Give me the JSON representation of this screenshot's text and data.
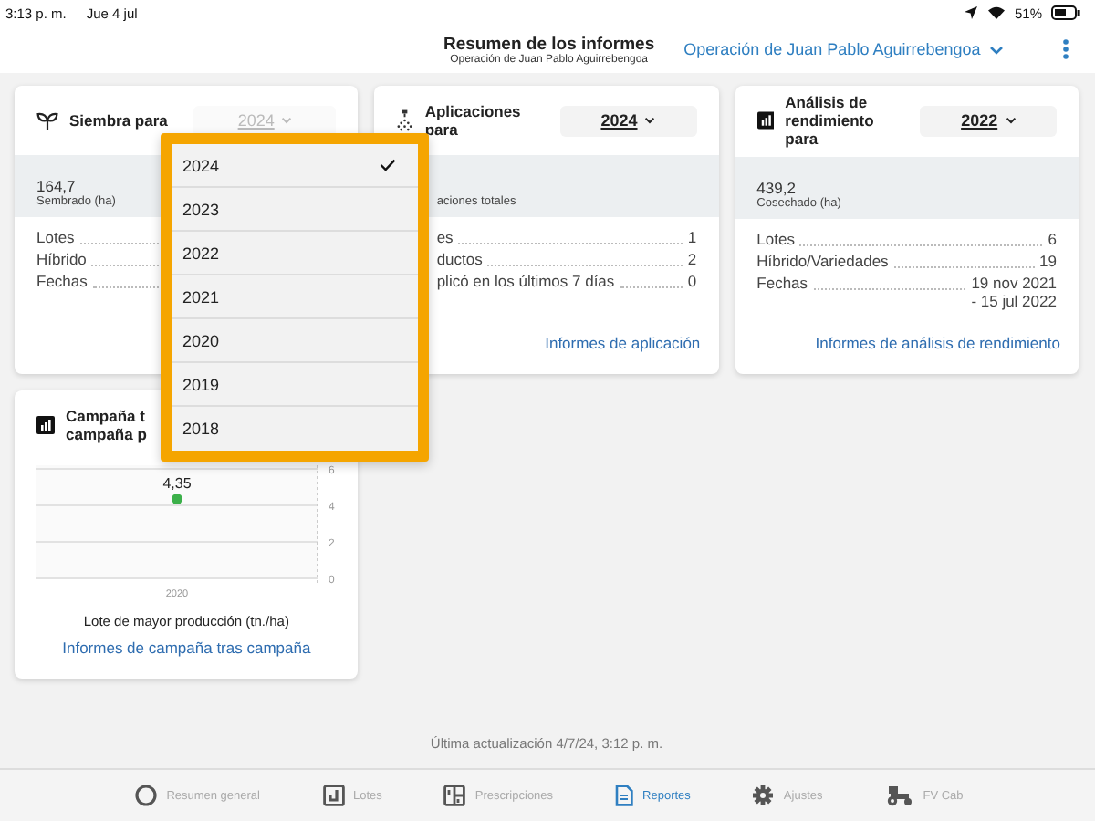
{
  "status_bar": {
    "time": "3:13 p. m.",
    "date": "Jue 4 jul",
    "battery": "51%"
  },
  "header": {
    "title": "Resumen de los informes",
    "subtitle": "Operación de Juan Pablo Aguirrebengoa",
    "operation": "Operación de Juan Pablo Aguirrebengoa"
  },
  "cards": [
    {
      "kind": "summary",
      "title": "Siembra para",
      "year": "2024",
      "open": true,
      "stat_value": "164,7",
      "stat_label": "Sembrado (ha)",
      "rows": [
        {
          "label": "Lotes"
        },
        {
          "label": "Híbrido"
        },
        {
          "label": "Fechas"
        }
      ]
    },
    {
      "kind": "summary",
      "title": "Aplicaciones para",
      "year": "2024",
      "open": false,
      "stat_label": "aciones totales",
      "rows": [
        {
          "label": "es",
          "value": "1"
        },
        {
          "label": "ductos",
          "value": "2"
        },
        {
          "label": "plicó en los últimos 7 días",
          "value": "0"
        }
      ],
      "link": "Informes de aplicación"
    },
    {
      "kind": "summary",
      "title": "Análisis de rendimiento para",
      "year": "2022",
      "open": false,
      "stat_value": "439,2",
      "stat_label": "Cosechado (ha)",
      "rows": [
        {
          "label": "Lotes",
          "value": "6"
        },
        {
          "label": "Híbrido/Variedades",
          "value": "19"
        },
        {
          "label": "Fechas",
          "value": "19 nov 2021\n- 15 jul 2022"
        }
      ],
      "link": "Informes de análisis de rendimiento"
    },
    {
      "kind": "chart",
      "title_lines": [
        "Campaña t",
        "campaña p"
      ],
      "chart_data": {
        "type": "scatter",
        "categories": [
          "2020"
        ],
        "series": [
          {
            "color": "#3cb04a",
            "values": [
              4.35
            ]
          }
        ],
        "ylim": [
          0,
          6
        ],
        "yticks": [
          0,
          2,
          4,
          6
        ],
        "value_labels": [
          "4,35"
        ]
      },
      "caption": "Lote de mayor producción (tn./ha)",
      "link": "Informes de campaña tras campaña"
    }
  ],
  "year_menu": {
    "items": [
      {
        "label": "2024",
        "selected": true
      },
      {
        "label": "2023",
        "selected": false
      },
      {
        "label": "2022",
        "selected": false
      },
      {
        "label": "2021",
        "selected": false
      },
      {
        "label": "2020",
        "selected": false
      },
      {
        "label": "2019",
        "selected": false
      },
      {
        "label": "2018",
        "selected": false
      }
    ]
  },
  "last_update": "Última actualización 4/7/24, 3:12 p. m.",
  "tabs": [
    {
      "label": "Resumen general",
      "selected": false
    },
    {
      "label": "Lotes",
      "selected": false
    },
    {
      "label": "Prescripciones",
      "selected": false
    },
    {
      "label": "Reportes",
      "selected": true
    },
    {
      "label": "Ajustes",
      "selected": false
    },
    {
      "label": "FV Cab",
      "selected": false
    }
  ]
}
